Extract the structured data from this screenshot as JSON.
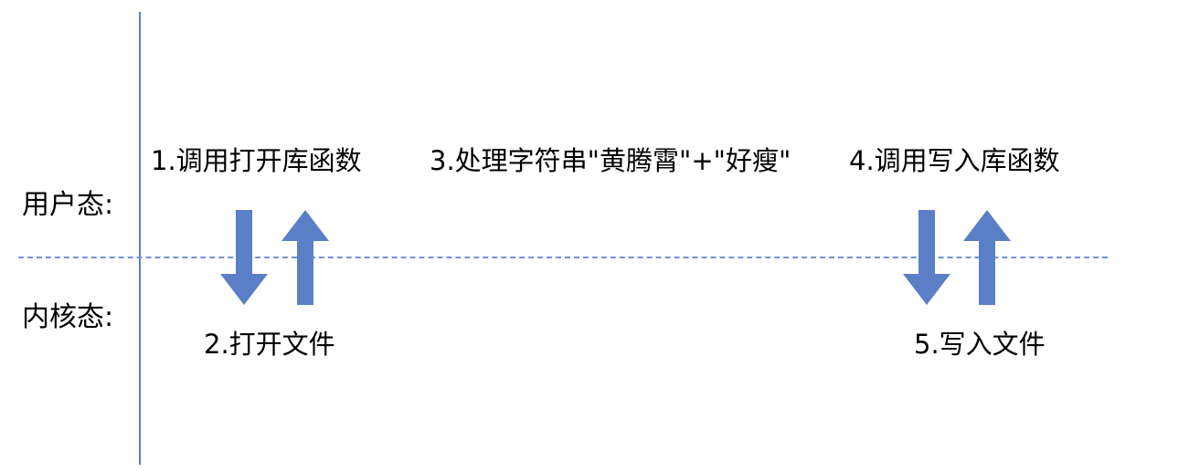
{
  "lanes": {
    "user": "用户态:",
    "kernel": "内核态:"
  },
  "steps": {
    "s1": "1.调用打开库函数",
    "s2": "2.打开文件",
    "s3": "3.处理字符串\"黄腾霄\"+\"好瘦\"",
    "s4": "4.调用写入库函数",
    "s5": "5.写入文件"
  },
  "colors": {
    "arrow": "#5b7fc7",
    "divider": "#6f93d6",
    "axis": "#5b7fc7"
  },
  "icons": {
    "down": "arrow-down-icon",
    "up": "arrow-up-icon"
  }
}
